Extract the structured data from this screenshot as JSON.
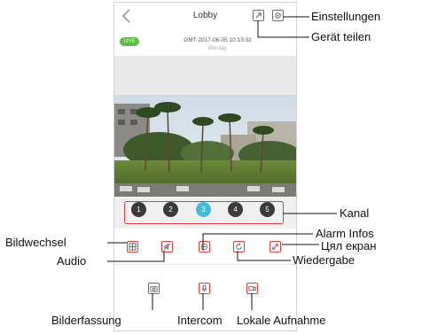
{
  "screen": {
    "title": "Lobby",
    "live_badge": "LIVE",
    "timestamp": "GMT 2017-06-05 10:13:02",
    "weekday": "Monday",
    "channels": [
      "1",
      "2",
      "3",
      "4",
      "5"
    ],
    "active_channel": "3"
  },
  "annotations": {
    "settings": "Einstellungen",
    "share": "Gerät teilen",
    "channel": "Kanal",
    "alarm": "Alarm Infos",
    "fullscreen": "Цял екран",
    "playback": "Wiedergabe",
    "image_switch": "Bildwechsel",
    "audio": "Audio",
    "snapshot": "Bilderfassung",
    "intercom": "Intercom",
    "local_record": "Lokale Aufnahme"
  },
  "colors": {
    "callout": "#e23b3b",
    "live": "#5dbb46",
    "active_channel": "#42bcd8",
    "channel": "#3a3a3a"
  },
  "icons": {
    "back": "chevron-left-icon",
    "share": "share-icon",
    "settings": "gear-icon",
    "image_switch": "layout-icon",
    "audio": "speaker-mute-icon",
    "alarm": "alarm-message-icon",
    "playback": "playback-icon",
    "fullscreen": "expand-icon",
    "snapshot": "camera-icon",
    "intercom": "microphone-icon",
    "local_record": "video-record-icon"
  }
}
